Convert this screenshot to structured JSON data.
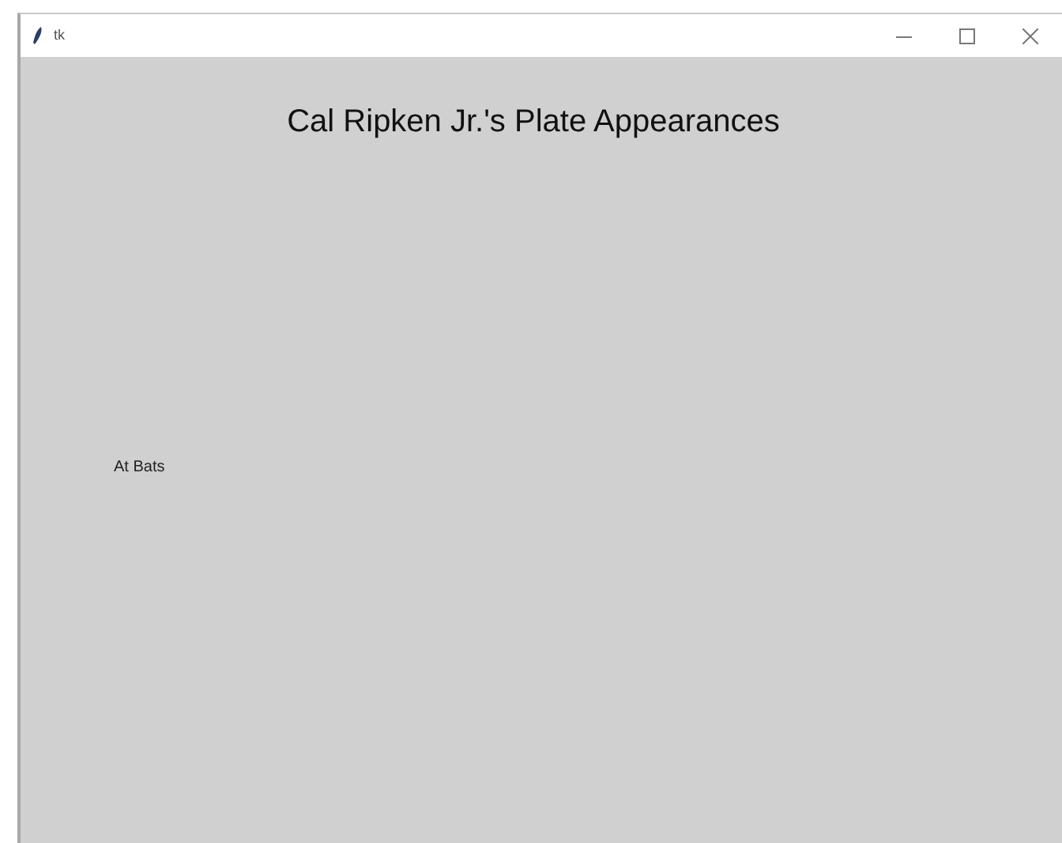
{
  "window": {
    "title": "tk"
  },
  "canvas": {
    "title": "Cal Ripken Jr.'s Plate Appearances",
    "label": "At Bats"
  }
}
